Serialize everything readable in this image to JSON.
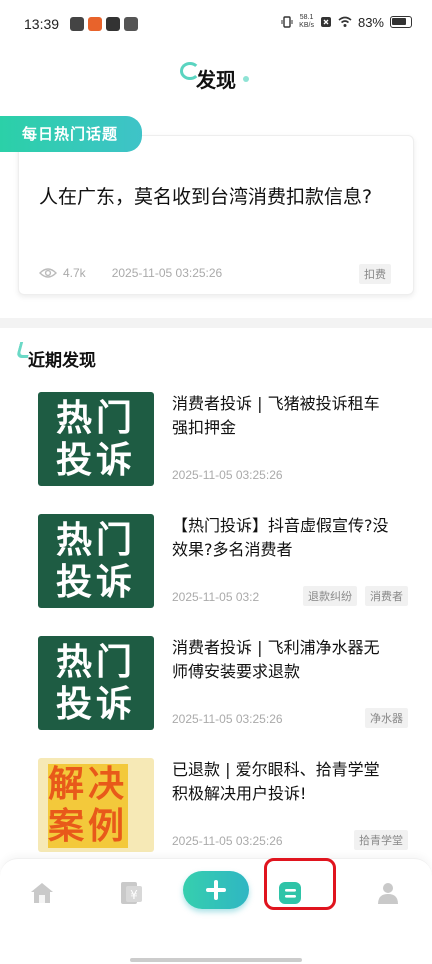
{
  "status_bar": {
    "time": "13:39",
    "net_speed_value": "58.1",
    "net_speed_unit": "KB/s",
    "battery": "83%"
  },
  "header": {
    "title": "发现"
  },
  "hot_topic": {
    "banner": "每日热门话题",
    "title": "人在广东，莫名收到台湾消费扣款信息?",
    "views": "4.7k",
    "date": "2025-11-05 03:25:26",
    "tag": "扣费"
  },
  "recent": {
    "section_title": "近期发现",
    "items": [
      {
        "thumb_line1": "热门",
        "thumb_line2": "投诉",
        "title": "消费者投诉 | 飞猪被投诉租车强扣押金",
        "date": "2025-11-05 03:25:26",
        "tags": []
      },
      {
        "thumb_line1": "热门",
        "thumb_line2": "投诉",
        "title": "【热门投诉】抖音虚假宣传?没效果?多名消费者",
        "date": "2025-11-05 03:2",
        "tags": [
          "退款纠纷",
          "消费者"
        ]
      },
      {
        "thumb_line1": "热门",
        "thumb_line2": "投诉",
        "title": "消费者投诉 | 飞利浦净水器无师傅安装要求退款",
        "date": "2025-11-05 03:25:26",
        "tags": [
          "净水器"
        ]
      },
      {
        "thumb_line1": "解决",
        "thumb_line2": "案例",
        "title": "已退款 | 爱尔眼科、拾青学堂积极解决用户投诉!",
        "date": "2025-11-05 03:25:26",
        "tags": [
          "拾青学堂"
        ]
      }
    ]
  },
  "bottom_nav": {
    "items": [
      "home-icon",
      "bill-icon",
      "add-icon",
      "discover-icon",
      "profile-icon"
    ],
    "accent_color": "#36cfae",
    "highlight_color": "#e0141e"
  }
}
